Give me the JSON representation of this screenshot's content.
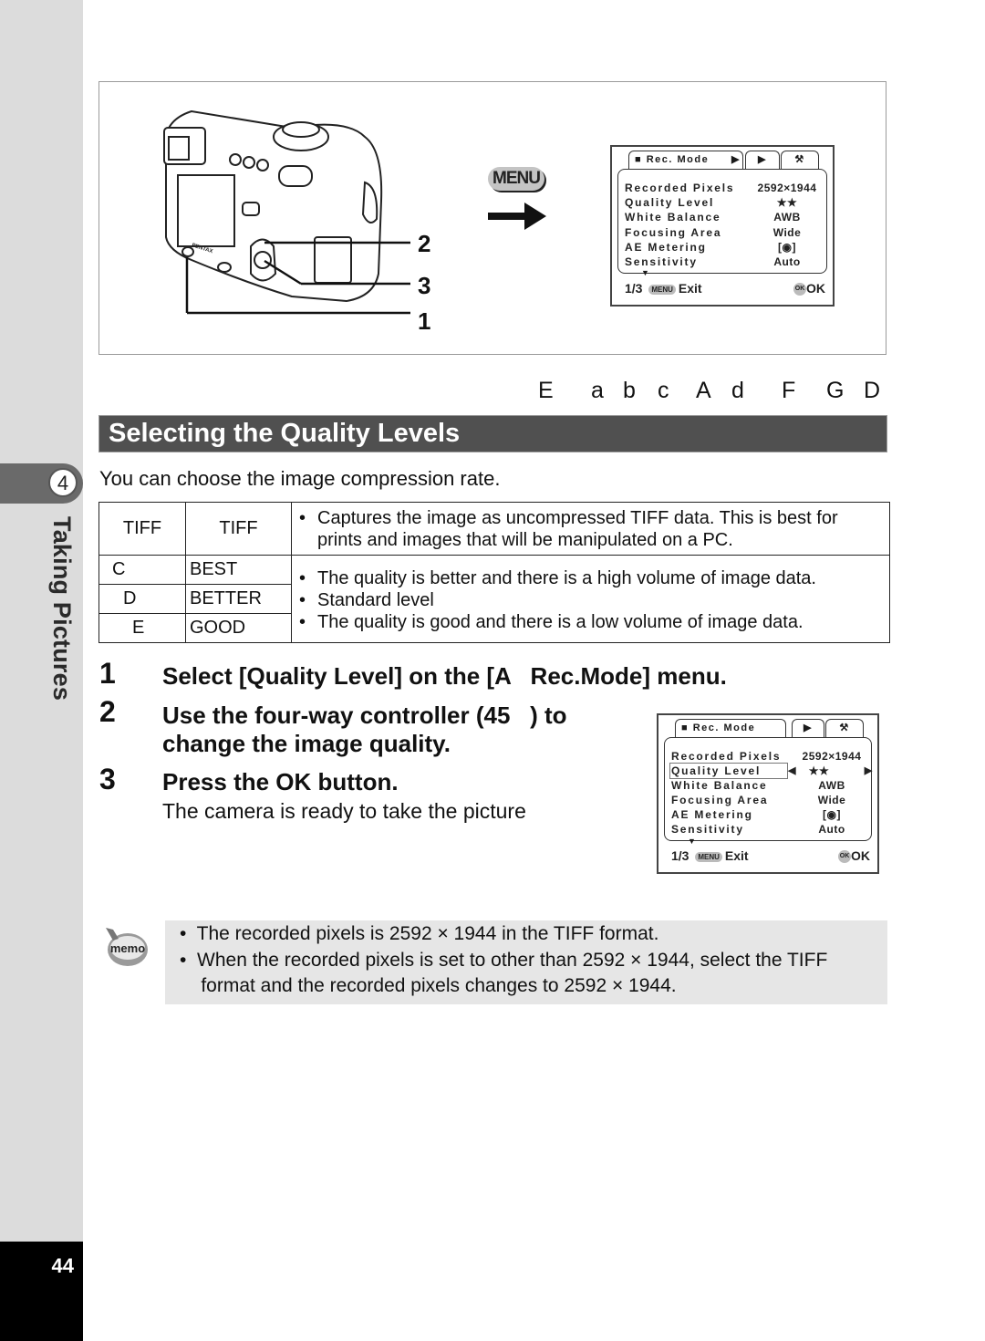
{
  "sidebar": {
    "chapter_number": "4",
    "chapter_title": "Taking Pictures",
    "page_number": "44"
  },
  "figure": {
    "callouts": [
      "2",
      "3",
      "1"
    ],
    "menu_button_label": "MENU",
    "camera_brand": "PENTAX"
  },
  "lcd_top": {
    "tab_rec_mode": "Rec. Mode",
    "rows": [
      {
        "label": "Recorded Pixels",
        "value": "2592×1944"
      },
      {
        "label": "Quality Level",
        "value": "★★"
      },
      {
        "label": "White Balance",
        "value": "AWB"
      },
      {
        "label": "Focusing Area",
        "value": "Wide"
      },
      {
        "label": "AE Metering",
        "value": "[◉]"
      },
      {
        "label": "Sensitivity",
        "value": "Auto"
      }
    ],
    "page": "1/3",
    "menu_pill": "MENU",
    "exit_label": "Exit",
    "ok_pill": "OK",
    "ok_label": "OK"
  },
  "symbol_row": [
    "E",
    "a",
    "b",
    "c",
    "A",
    "d",
    "F",
    "G",
    "D"
  ],
  "section": {
    "title": "Selecting the Quality Levels",
    "intro": "You can choose the image compression rate."
  },
  "quality_table": {
    "rows": [
      {
        "icon": "TIFF",
        "name": "TIFF",
        "desc": [
          "Captures the image as uncompressed TIFF data. This is best for prints and images that will be manipulated on a PC."
        ]
      },
      {
        "icon": "C",
        "name": "BEST",
        "desc": [
          "The quality is better and there is a high volume of image data."
        ]
      },
      {
        "icon": "D",
        "name": "BETTER",
        "desc": [
          "Standard level"
        ]
      },
      {
        "icon": "E",
        "name": "GOOD",
        "desc": [
          "The quality is good and there is a low volume of image data."
        ]
      }
    ]
  },
  "steps": [
    {
      "num": "1",
      "text": "Select [Quality Level] on the [A   Rec.Mode] menu."
    },
    {
      "num": "2",
      "text": "Use the four-way controller (45   ) to",
      "text2": "change the image quality."
    },
    {
      "num": "3",
      "text": "Press the OK button.",
      "sub": "The camera is ready to take the picture"
    }
  ],
  "lcd_bottom": {
    "tab_rec_mode": "Rec. Mode",
    "rows": [
      {
        "label": "Recorded Pixels",
        "value": "2592×1944"
      },
      {
        "label": "Quality Level",
        "value": "★★",
        "selected": true
      },
      {
        "label": "White Balance",
        "value": "AWB"
      },
      {
        "label": "Focusing Area",
        "value": "Wide"
      },
      {
        "label": "AE Metering",
        "value": "[◉]"
      },
      {
        "label": "Sensitivity",
        "value": "Auto"
      }
    ],
    "page": "1/3",
    "menu_pill": "MENU",
    "exit_label": "Exit",
    "ok_pill": "OK",
    "ok_label": "OK"
  },
  "memo": {
    "icon_label": "memo",
    "lines": [
      "•  The recorded pixels is 2592 × 1944 in the TIFF format.",
      "•  When the recorded pixels is set to other than 2592 × 1944, select the TIFF",
      "    format and the recorded pixels changes to 2592 × 1944."
    ]
  }
}
